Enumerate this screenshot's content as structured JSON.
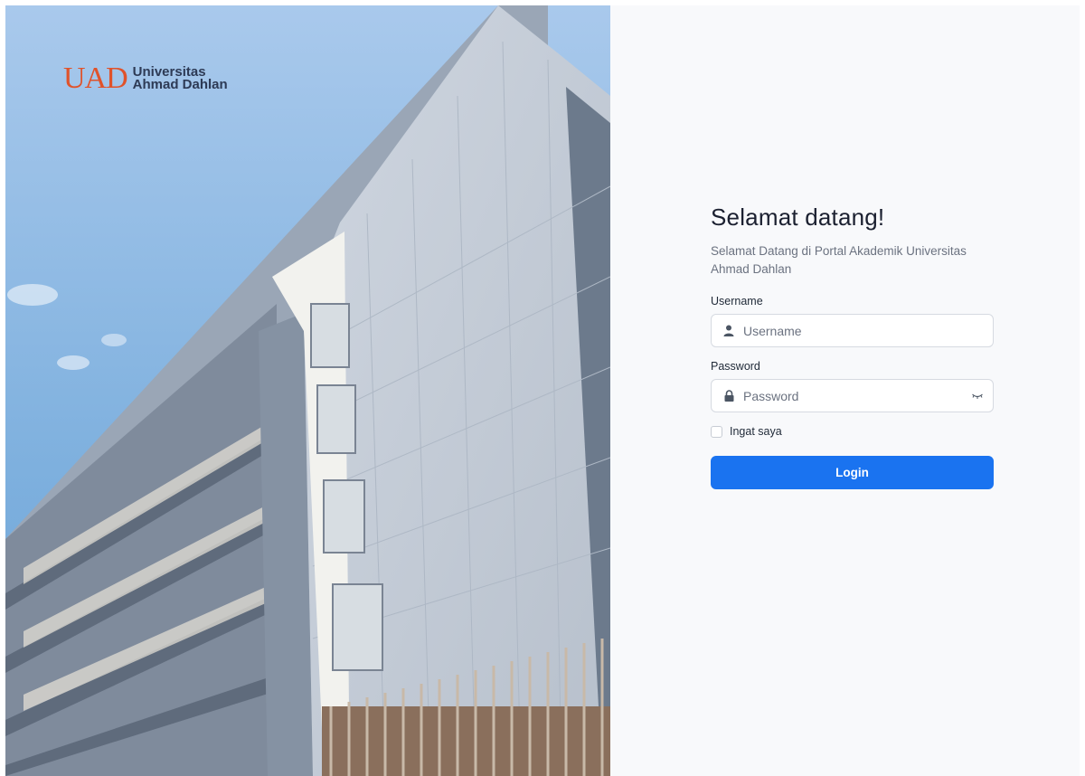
{
  "brand": {
    "mark": "UAD",
    "line1": "Universitas",
    "line2": "Ahmad Dahlan",
    "color": "#e0522a"
  },
  "login": {
    "title": "Selamat datang!",
    "subtitle": "Selamat Datang di Portal Akademik Universitas Ahmad Dahlan",
    "username_label": "Username",
    "username_placeholder": "Username",
    "password_label": "Password",
    "password_placeholder": "Password",
    "remember_label": "Ingat saya",
    "button_label": "Login",
    "button_color": "#1a73f0"
  },
  "icons": {
    "username": "user-icon",
    "password": "lock-icon",
    "toggle": "eye-closed-icon"
  }
}
